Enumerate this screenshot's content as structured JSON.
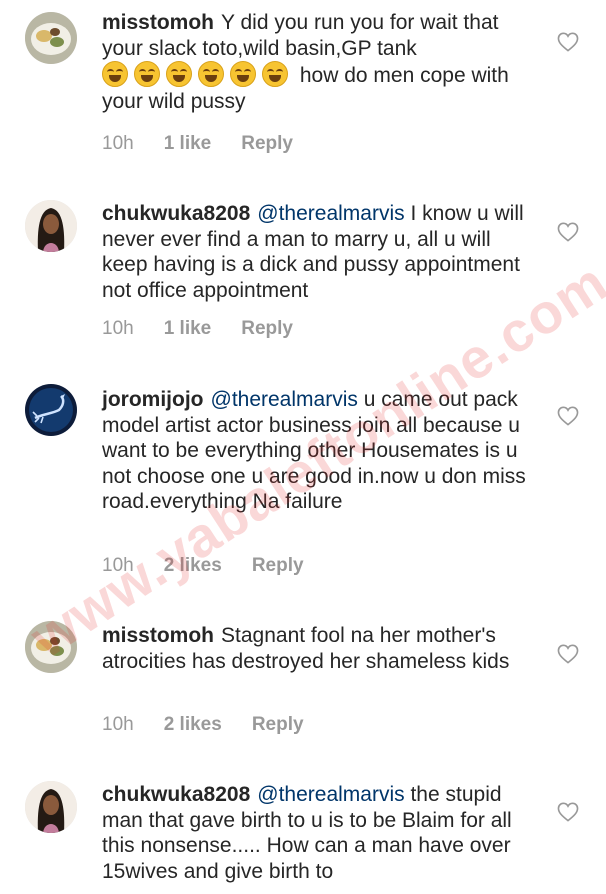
{
  "watermark": "www.yabaleftonline.com",
  "comments": [
    {
      "username": "misstomoh",
      "avatar_icon": "food-plate-avatar",
      "text_before": "Y did you run you for wait that your slack toto,wild basin,GP tank",
      "emoji": [
        "😂",
        "😂",
        "😂",
        "😂",
        "😂",
        "😂"
      ],
      "text_after": "how do men cope with your wild pussy",
      "time": "10h",
      "likes": "1 like",
      "reply": "Reply"
    },
    {
      "username": "chukwuka8208",
      "avatar_icon": "woman-portrait-avatar",
      "mention": "@therealmarvis",
      "text": "I know u will never ever find a man to marry u, all u will keep having is a dick and pussy appointment not office appointment",
      "time": "10h",
      "likes": "1 like",
      "reply": "Reply"
    },
    {
      "username": "joromijojo",
      "avatar_icon": "scorpion-avatar",
      "mention": "@therealmarvis",
      "text": "u came out pack model artist actor business join all because u want to be everything other Housemates is u not choose one u are good in.now u don miss road.everything Na failure",
      "time": "10h",
      "likes": "2 likes",
      "reply": "Reply"
    },
    {
      "username": "misstomoh",
      "avatar_icon": "food-plate-avatar",
      "text": "Stagnant fool na her mother's atrocities has destroyed her shameless kids",
      "time": "10h",
      "likes": "2 likes",
      "reply": "Reply"
    },
    {
      "username": "chukwuka8208",
      "avatar_icon": "woman-portrait-avatar",
      "mention": "@therealmarvis",
      "text": "the stupid man that gave birth to u is to be Blaim for all this nonsense..... How can a man have over 15wives and give birth to"
    }
  ]
}
